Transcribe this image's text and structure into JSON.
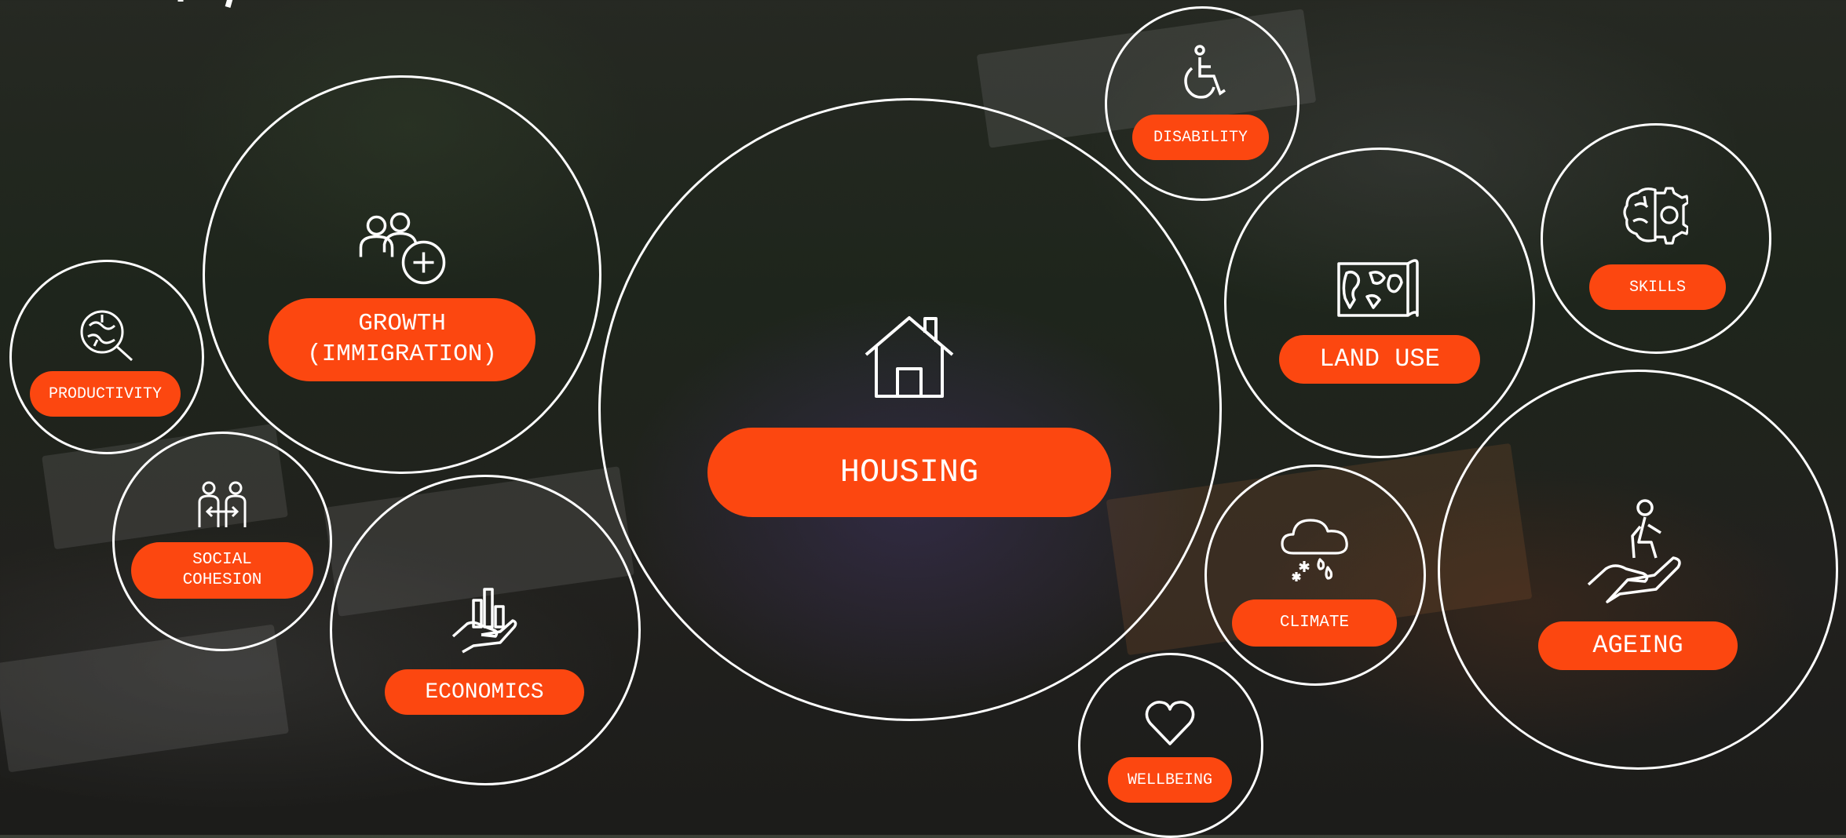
{
  "colors": {
    "accent": "#fc4710",
    "outline": "#ffffff"
  },
  "topics": [
    {
      "id": "housing",
      "label": "HOUSING",
      "icon": "house-icon"
    },
    {
      "id": "growth",
      "label": "GROWTH\n(IMMIGRATION)",
      "icon": "people-add-icon"
    },
    {
      "id": "productivity",
      "label": "PRODUCTIVITY",
      "icon": "brain-search-icon"
    },
    {
      "id": "social",
      "label": "SOCIAL\nCOHESION",
      "icon": "people-exchange-icon"
    },
    {
      "id": "economics",
      "label": "ECONOMICS",
      "icon": "hand-chart-icon"
    },
    {
      "id": "disability",
      "label": "DISABILITY",
      "icon": "wheelchair-icon"
    },
    {
      "id": "landuse",
      "label": "LAND USE",
      "icon": "map-icon"
    },
    {
      "id": "skills",
      "label": "SKILLS",
      "icon": "brain-gear-icon"
    },
    {
      "id": "climate",
      "label": "CLIMATE",
      "icon": "cloud-weather-icon"
    },
    {
      "id": "ageing",
      "label": "AGEING",
      "icon": "hand-person-icon"
    },
    {
      "id": "wellbeing",
      "label": "WELLBEING",
      "icon": "heart-icon"
    }
  ]
}
